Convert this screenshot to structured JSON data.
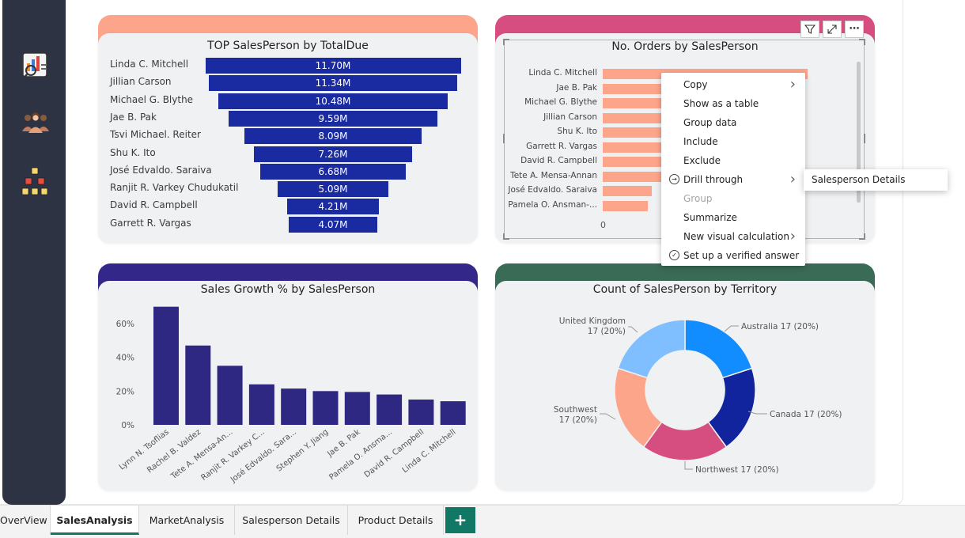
{
  "funnel": {
    "title": "TOP SalesPerson by TotalDue",
    "items": [
      {
        "name": "Linda C. Mitchell",
        "label": "11.70M",
        "value": 11.7
      },
      {
        "name": "Jillian Carson",
        "label": "11.34M",
        "value": 11.34
      },
      {
        "name": "Michael G. Blythe",
        "label": "10.48M",
        "value": 10.48
      },
      {
        "name": "Jae B. Pak",
        "label": "9.59M",
        "value": 9.59
      },
      {
        "name": "Tsvi Michael. Reiter",
        "label": "8.09M",
        "value": 8.09
      },
      {
        "name": "Shu K. Ito",
        "label": "7.26M",
        "value": 7.26
      },
      {
        "name": "José Edvaldo. Saraiva",
        "label": "6.68M",
        "value": 6.68
      },
      {
        "name": "Ranjit R. Varkey Chudukatil",
        "label": "5.09M",
        "value": 5.09
      },
      {
        "name": "David R. Campbell",
        "label": "4.21M",
        "value": 4.21
      },
      {
        "name": "Garrett R. Vargas",
        "label": "4.07M",
        "value": 4.07
      }
    ]
  },
  "orders": {
    "title": "No. Orders by SalesPerson",
    "axis_zero": "0",
    "items": [
      {
        "name": "Linda C. Mitchell",
        "value": 1.0
      },
      {
        "name": "Jae B. Pak",
        "value": 0.93
      },
      {
        "name": "Michael G. Blythe",
        "value": 0.88
      },
      {
        "name": "Jillian Carson",
        "value": 0.85
      },
      {
        "name": "Shu K. Ito",
        "value": 0.72
      },
      {
        "name": "Garrett R. Vargas",
        "value": 0.7
      },
      {
        "name": "David R. Campbell",
        "value": 0.63
      },
      {
        "name": "Tete A. Mensa-Annan",
        "value": 0.5
      },
      {
        "name": "José Edvaldo. Saraiva",
        "value": 0.24
      },
      {
        "name": "Pamela O. Ansman-...",
        "value": 0.22
      }
    ]
  },
  "toolbar": {
    "filter_icon": "filter-icon",
    "focus_icon": "focus-mode-icon",
    "more_label": "⋯"
  },
  "context_menu": {
    "items": [
      {
        "label": "Copy",
        "submenu": true,
        "disabled": false,
        "icon": ""
      },
      {
        "label": "Show as a table",
        "submenu": false,
        "disabled": false,
        "icon": ""
      },
      {
        "label": "Group data",
        "submenu": false,
        "disabled": false,
        "icon": ""
      },
      {
        "label": "Include",
        "submenu": false,
        "disabled": false,
        "icon": ""
      },
      {
        "label": "Exclude",
        "submenu": false,
        "disabled": false,
        "icon": ""
      },
      {
        "label": "Drill through",
        "submenu": true,
        "disabled": false,
        "icon": "drill-through-icon"
      },
      {
        "label": "Group",
        "submenu": false,
        "disabled": true,
        "icon": ""
      },
      {
        "label": "Summarize",
        "submenu": false,
        "disabled": false,
        "icon": ""
      },
      {
        "label": "New visual calculation",
        "submenu": true,
        "disabled": false,
        "icon": ""
      },
      {
        "label": "Set up a verified answer",
        "submenu": false,
        "disabled": false,
        "icon": "verified-answer-icon"
      }
    ],
    "submenu_item": "Salesperson Details"
  },
  "growth": {
    "title": "Sales Growth % by SalesPerson"
  },
  "territory": {
    "title": "Count of SalesPerson by Territory"
  },
  "chart_data": [
    {
      "type": "bar",
      "title": "Sales Growth % by SalesPerson",
      "categories": [
        "Lynn N. Tsoflias",
        "Rachel B. Valdez",
        "Tete A. Mensa-An...",
        "Ranjit R. Varkey C...",
        "José Edvaldo. Sara...",
        "Stephen Y. Jiang",
        "Jae B. Pak",
        "Pamela O. Ansma...",
        "David R. Campbell",
        "Linda C. Mitchell"
      ],
      "values": [
        70,
        47,
        35,
        24,
        21.5,
        20,
        19.5,
        18,
        15,
        14
      ],
      "yticks": [
        "0%",
        "20%",
        "40%",
        "60%"
      ],
      "ylim": [
        0,
        75
      ],
      "color": "#2e2882"
    },
    {
      "type": "pie",
      "title": "Count of SalesPerson by Territory",
      "slices": [
        {
          "name": "Australia",
          "label": "Australia 17 (20%)",
          "value": 20,
          "color": "#118dff"
        },
        {
          "name": "Canada",
          "label": "Canada 17 (20%)",
          "value": 20,
          "color": "#12239e"
        },
        {
          "name": "Northwest",
          "label": "Northwest 17 (20%)",
          "value": 20,
          "color": "#d64d7f"
        },
        {
          "name": "Southwest",
          "label_line1": "Southwest",
          "label_line2": "17 (20%)",
          "value": 20,
          "color": "#fda58a"
        },
        {
          "name": "United Kingdom",
          "label_line1": "United Kingdom",
          "label_line2": "17 (20%)",
          "value": 20,
          "color": "#7fbfff"
        }
      ]
    }
  ],
  "tabs": [
    {
      "label": "OverView",
      "active": false
    },
    {
      "label": "SalesAnalysis",
      "active": true
    },
    {
      "label": "MarketAnalysis",
      "active": false
    },
    {
      "label": "Salesperson Details",
      "active": false
    },
    {
      "label": "Product Details",
      "active": false
    }
  ],
  "add_tab_label": "+",
  "colors": {
    "nav": "#2e3344",
    "funnel_bar": "#1a2aa0",
    "orders_bar": "#fda58a",
    "accent": "#117865"
  }
}
